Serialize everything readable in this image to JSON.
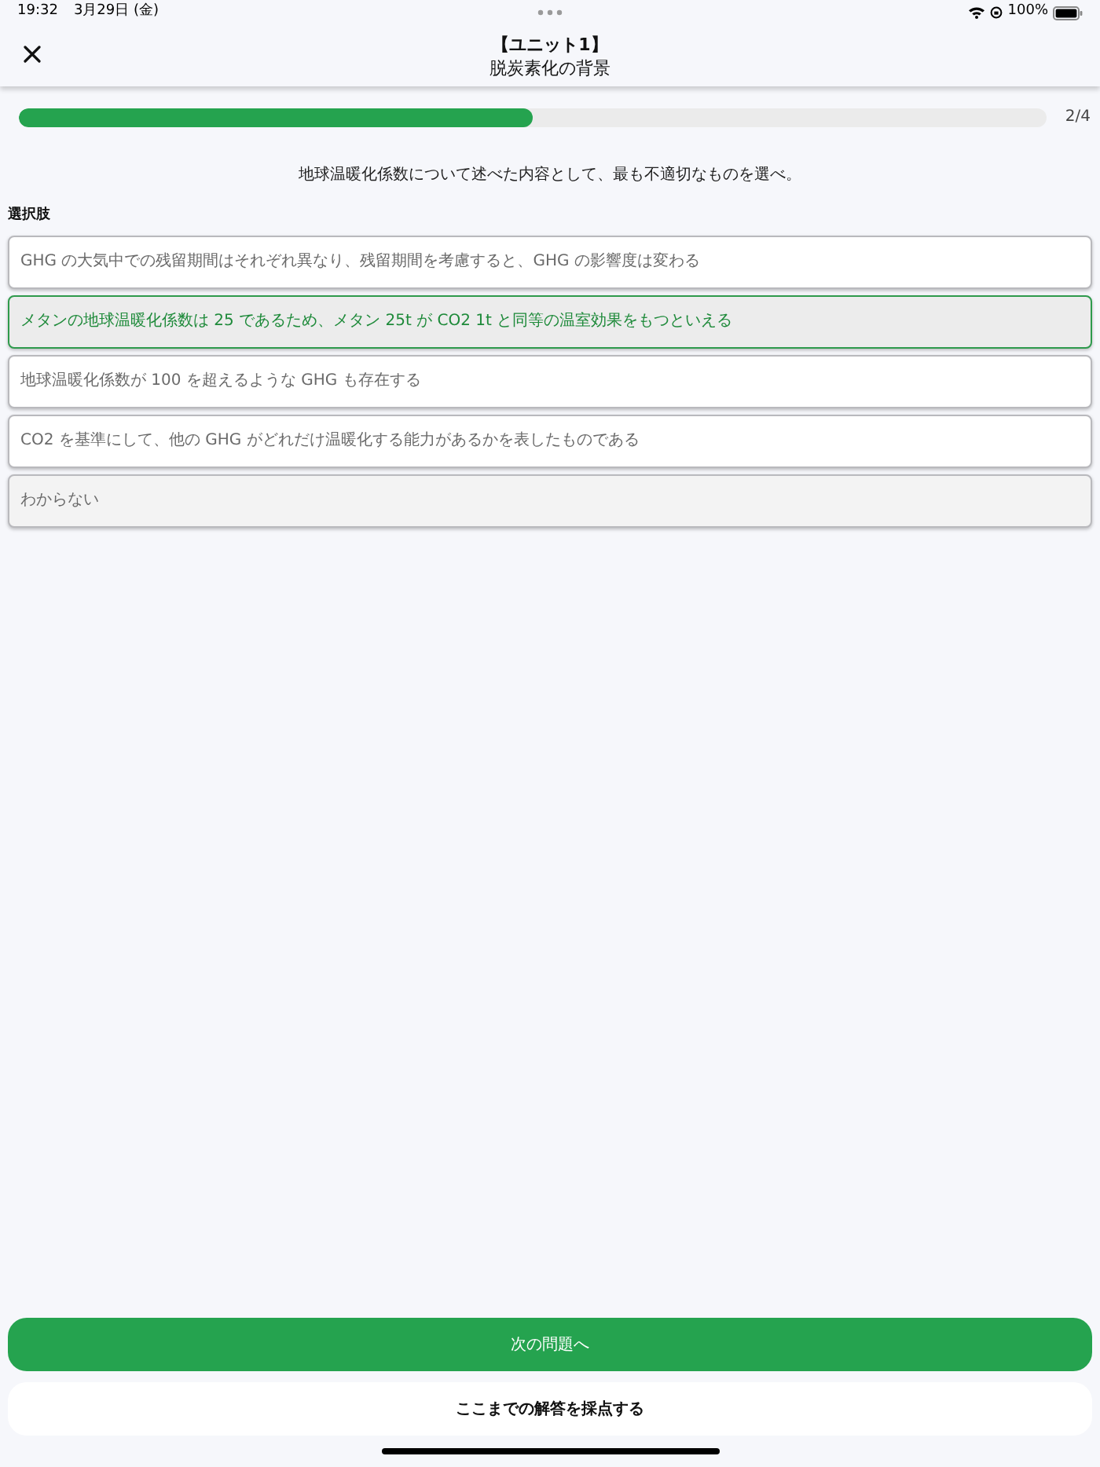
{
  "status_bar": {
    "time": "19:32",
    "date": "3月29日 (金)",
    "battery": "100%"
  },
  "header": {
    "title": "【ユニット1】",
    "subtitle": "脱炭素化の背景"
  },
  "progress": {
    "level": 0.5,
    "label": "2/4"
  },
  "question": "地球温暖化係数について述べた内容として、最も不適切なものを選べ。",
  "choices_label": "選択肢",
  "choices": [
    {
      "kind": "answer",
      "text": "GHG の大気中での残留期間はそれぞれ異なり、残留期間を考慮すると、GHG の影響度は変わる",
      "selected": false
    },
    {
      "kind": "answer",
      "text": "メタンの地球温暖化係数は 25 であるため、メタン 25t が CO2 1t と同等の温室効果をもつといえる",
      "selected": true
    },
    {
      "kind": "answer",
      "text": "地球温暖化係数が 100 を超えるような GHG も存在する",
      "selected": false
    },
    {
      "kind": "answer",
      "text": "CO2 を基準にして、他の GHG がどれだけ温暖化する能力があるかを表したものである",
      "selected": false
    },
    {
      "kind": "unknown",
      "text": "わからない",
      "selected": false
    }
  ],
  "buttons": {
    "next": "次の問題へ",
    "grade": "ここまでの解答を採点する"
  }
}
